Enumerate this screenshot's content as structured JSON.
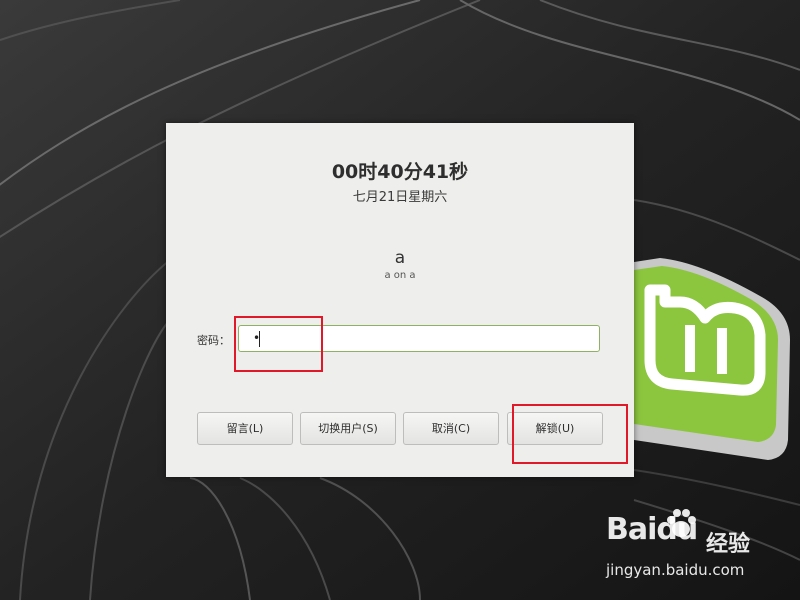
{
  "lock_screen": {
    "clock": "00时40分41秒",
    "date": "七月21日星期六",
    "username": "a",
    "host_line": "a on a",
    "password_label": "密码：",
    "password_value": "•",
    "buttons": {
      "logout": "留言(L)",
      "switch_user": "切换用户(S)",
      "cancel": "取消(C)",
      "unlock": "解锁(U)"
    }
  },
  "watermark": {
    "brand": "Baidu",
    "brand_suffix": "经验",
    "url": "jingyan.baidu.com"
  },
  "colors": {
    "dialog_bg": "#eeeeec",
    "mint_green": "#8cc63f",
    "annotation_red": "#e0182a",
    "desktop_bg": "#1e1e1e"
  },
  "icons": [
    "linux-mint-logo-icon",
    "baidu-paw-icon"
  ]
}
